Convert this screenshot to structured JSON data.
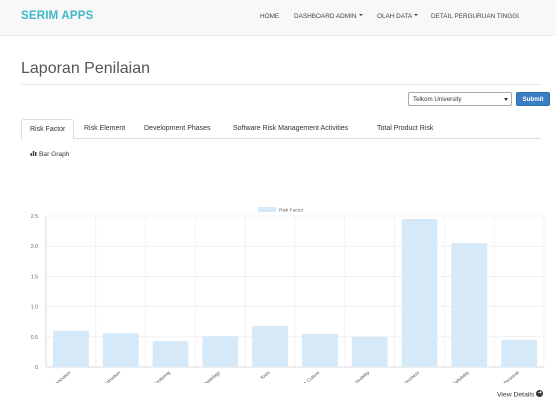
{
  "app": {
    "brand": "SERIM APPS"
  },
  "nav": {
    "home": "HOME",
    "dashboard_admin": "DASHBOARD ADMIN",
    "olah_data": "OLAH DATA",
    "detail_perguruan": "DETAIL PERGURUAN TINGGI"
  },
  "page": {
    "title": "Laporan Penilaian"
  },
  "filter": {
    "selected_university": "Telkom University",
    "submit_label": "Submit"
  },
  "tabs": [
    {
      "label": "Risk Factor",
      "active": true
    },
    {
      "label": "Risk Element",
      "active": false
    },
    {
      "label": "Development Phases",
      "active": false
    },
    {
      "label": "Software Risk Management Activities",
      "active": false
    },
    {
      "label": "Total Product Risk",
      "active": false
    }
  ],
  "graph": {
    "label": "Bar Graph",
    "icon": "bar-chart-icon"
  },
  "footer": {
    "view_details": "View Details"
  },
  "colors": {
    "bar_fill": "#d6e9f8",
    "accent": "#3a7fc1",
    "brand": "#3bb8c9"
  },
  "chart_data": {
    "type": "bar",
    "categories": [
      "Organization",
      "Estimation",
      "Monitoring",
      "Development Methodology",
      "Tools",
      "Risk Culture",
      "Usability",
      "Correctness",
      "Reliability",
      "Personal"
    ],
    "series": [
      {
        "name": "Risk Factor",
        "values": [
          0.6,
          0.56,
          0.43,
          0.51,
          0.68,
          0.55,
          0.5,
          2.45,
          2.05,
          0.45
        ]
      }
    ],
    "ylim": [
      0,
      2.5
    ],
    "yticks": [
      "0",
      "0.5",
      "1.0",
      "1.5",
      "2.0",
      "2.5"
    ],
    "grid": true,
    "legend": "top-center"
  }
}
